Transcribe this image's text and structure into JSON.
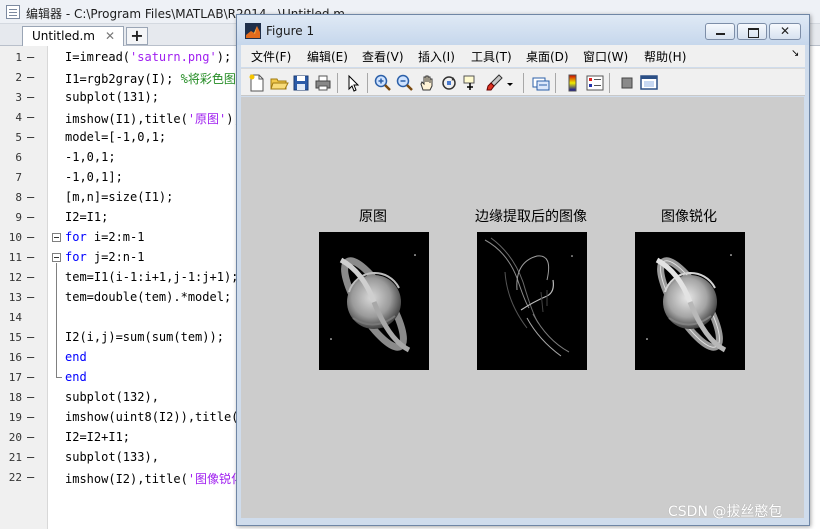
{
  "editor": {
    "title": "编辑器 - C:\\Program Files\\MATLAB\\R2014...\\Untitled.m",
    "tab_label": "Untitled.m",
    "tab_close": "✕",
    "tab_add": "+",
    "lines": [
      {
        "num": "1",
        "dash": "–",
        "text": "I=imread('saturn.png');"
      },
      {
        "num": "2",
        "dash": "–",
        "text": "I1=rgb2gray(I); %将彩色图"
      },
      {
        "num": "3",
        "dash": "–",
        "text": "subplot(131);"
      },
      {
        "num": "4",
        "dash": "–",
        "text": "imshow(I1),title('原图');"
      },
      {
        "num": "5",
        "dash": "–",
        "text": "model=[-1,0,1;"
      },
      {
        "num": "6",
        "dash": "",
        "text": "-1,0,1;"
      },
      {
        "num": "7",
        "dash": "",
        "text": "-1,0,1];"
      },
      {
        "num": "8",
        "dash": "–",
        "text": "[m,n]=size(I1);"
      },
      {
        "num": "9",
        "dash": "–",
        "text": "I2=I1;"
      },
      {
        "num": "10",
        "dash": "–",
        "text": "for i=2:m-1"
      },
      {
        "num": "11",
        "dash": "–",
        "text": "for j=2:n-1"
      },
      {
        "num": "12",
        "dash": "–",
        "text": "tem=I1(i-1:i+1,j-1:j+1);"
      },
      {
        "num": "13",
        "dash": "–",
        "text": "tem=double(tem).*model;"
      },
      {
        "num": "14",
        "dash": "",
        "text": ""
      },
      {
        "num": "15",
        "dash": "–",
        "text": "I2(i,j)=sum(sum(tem));"
      },
      {
        "num": "16",
        "dash": "–",
        "text": "end"
      },
      {
        "num": "17",
        "dash": "–",
        "text": "end"
      },
      {
        "num": "18",
        "dash": "–",
        "text": "subplot(132),"
      },
      {
        "num": "19",
        "dash": "–",
        "text": "imshow(uint8(I2)),title("
      },
      {
        "num": "20",
        "dash": "–",
        "text": "I2=I2+I1;"
      },
      {
        "num": "21",
        "dash": "–",
        "text": "subplot(133),"
      },
      {
        "num": "22",
        "dash": "–",
        "text": "imshow(I2),title('图像锐化"
      }
    ]
  },
  "figure": {
    "title": "Figure 1",
    "menus": [
      "文件(F)",
      "编辑(E)",
      "查看(V)",
      "插入(I)",
      "工具(T)",
      "桌面(D)",
      "窗口(W)",
      "帮助(H)"
    ],
    "menu_more": "↘",
    "toolbar_icons": [
      "new-figure-icon",
      "open-file-icon",
      "save-icon",
      "print-icon",
      "edit-plot-arrow-icon",
      "zoom-in-icon",
      "zoom-out-icon",
      "pan-hand-icon",
      "rotate-3d-icon",
      "data-cursor-icon",
      "brush-icon",
      "brush-dropdown-icon",
      "link-plot-icon",
      "insert-colorbar-icon",
      "insert-legend-icon",
      "hide-plot-tools-icon",
      "show-plot-tools-icon"
    ],
    "subplots": [
      {
        "title": "原图"
      },
      {
        "title": "边缘提取后的图像"
      },
      {
        "title": "图像锐化"
      }
    ]
  },
  "watermark": "CSDN @拔丝憨包",
  "colors": {
    "keyword": "#0000ff",
    "string": "#a020f0",
    "comment": "#228b22",
    "figure_background": "#cccccc"
  }
}
